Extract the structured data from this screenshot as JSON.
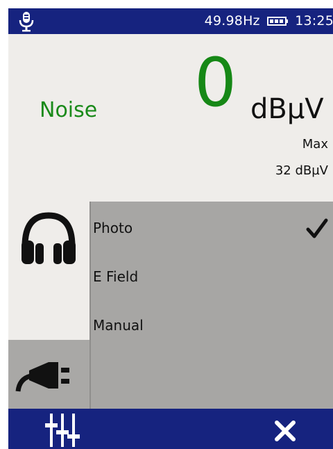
{
  "status": {
    "frequency": "49.98Hz",
    "time": "13:25",
    "icons": {
      "mic": "microphone-icon",
      "battery": "battery-icon"
    }
  },
  "measurement": {
    "mode": "Noise",
    "value": "0",
    "unit": "dBµV",
    "max_label": "Max",
    "max_value": "32 dBµV"
  },
  "options": [
    {
      "label": "Photo",
      "selected": true
    },
    {
      "label": "E Field",
      "selected": false
    },
    {
      "label": "Manual",
      "selected": false
    }
  ],
  "side_tabs": [
    {
      "icon": "headphones-icon",
      "active": true
    },
    {
      "icon": "power-plug-icon",
      "active": false
    }
  ],
  "bottom": {
    "left_icon": "sliders-icon",
    "right_icon": "close-icon"
  },
  "colors": {
    "bar": "#16237f",
    "value_green": "#168816",
    "panel": "#efedea",
    "options_bg": "#a7a6a4"
  }
}
